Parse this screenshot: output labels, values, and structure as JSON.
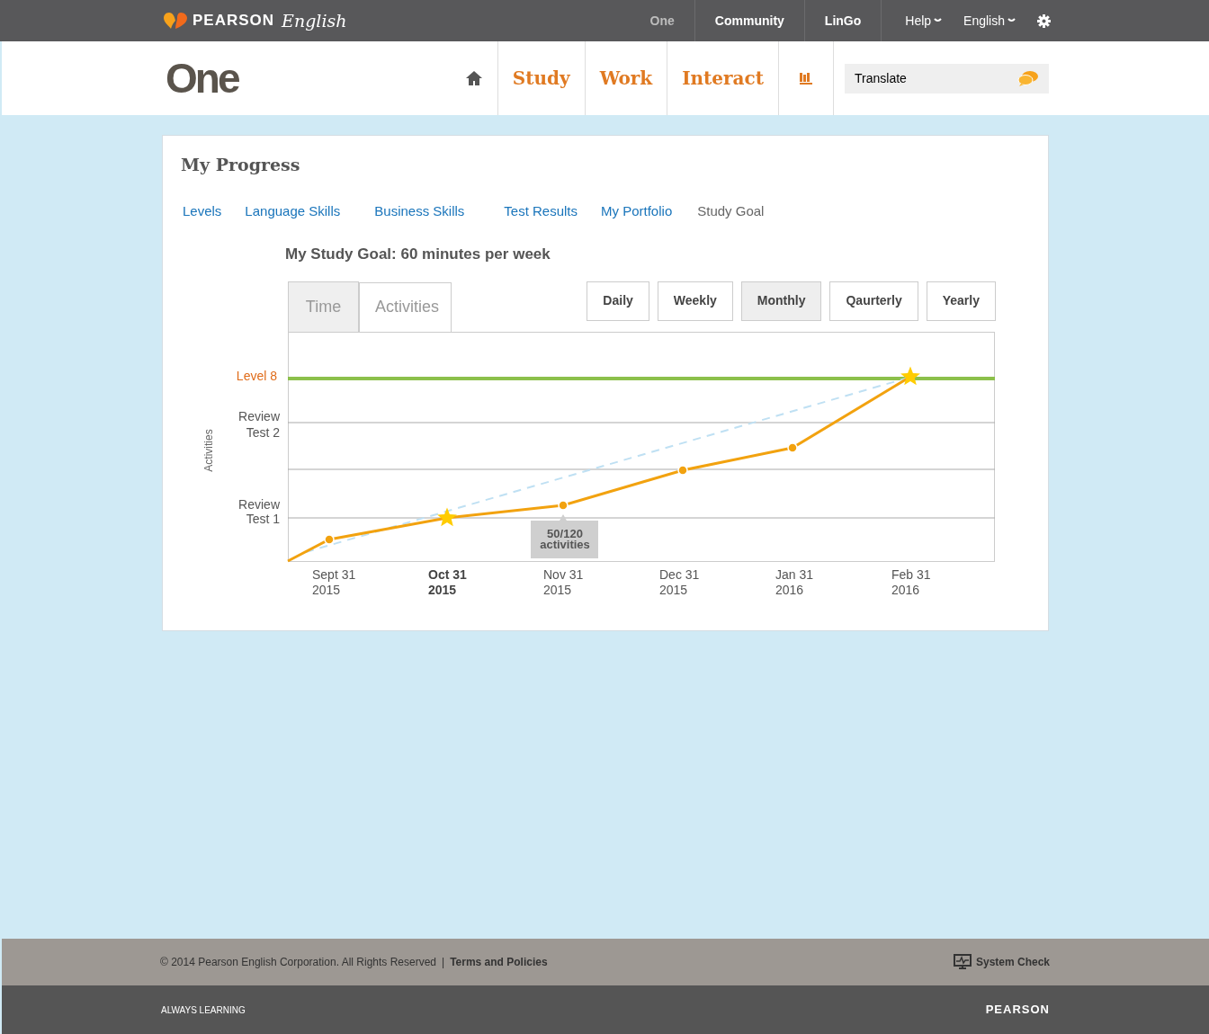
{
  "top_bar": {
    "brand": "PEARSON",
    "brand_script": "English",
    "links": [
      {
        "label": "One",
        "selected": true
      },
      {
        "label": "Community",
        "selected": false
      },
      {
        "label": "LinGo",
        "selected": false
      }
    ],
    "menus": [
      "Help",
      "English"
    ]
  },
  "header": {
    "logo": "One",
    "nav": [
      "Study",
      "Work",
      "Interact"
    ],
    "translate": {
      "label": "Translate"
    }
  },
  "card": {
    "title": "My Progress",
    "tabs": [
      {
        "label": "Levels",
        "selected": false
      },
      {
        "label": "Language Skills",
        "selected": false
      },
      {
        "label": "Business Skills",
        "selected": false
      },
      {
        "label": "Test Results",
        "selected": false
      },
      {
        "label": "My Portfolio",
        "selected": false
      },
      {
        "label": "Study Goal",
        "selected": true
      }
    ],
    "goal": "My Study Goal: 60 minutes per week",
    "view_tabs": [
      {
        "label": "Time",
        "selected": false
      },
      {
        "label": "Activities",
        "selected": true
      }
    ],
    "periods": [
      {
        "label": "Daily",
        "selected": false
      },
      {
        "label": "Weekly",
        "selected": false
      },
      {
        "label": "Monthly",
        "selected": true
      },
      {
        "label": "Qaurterly",
        "selected": false
      },
      {
        "label": "Yearly",
        "selected": false
      }
    ],
    "chart": {
      "y_title": "Activities",
      "goal_label": "Level 8",
      "y_labels": [
        [
          "Review",
          "Test 2"
        ],
        [
          "Review",
          "Test 1"
        ]
      ],
      "x_labels": [
        {
          "month": "Sept 31",
          "year": "2015",
          "selected": false
        },
        {
          "month": "Oct 31",
          "year": "2015",
          "selected": true
        },
        {
          "month": "Nov 31",
          "year": "2015",
          "selected": false
        },
        {
          "month": "Dec 31",
          "year": "2015",
          "selected": false
        },
        {
          "month": "Jan 31",
          "year": "2016",
          "selected": false
        },
        {
          "month": "Feb 31",
          "year": "2016",
          "selected": false
        }
      ],
      "tooltip": [
        "50/120",
        "activities"
      ]
    }
  },
  "footer": {
    "copyright": "© 2014 Pearson English Corporation. All Rights Reserved",
    "separator": "|",
    "terms": "Terms and Policies",
    "system_check": "System Check",
    "tagline": "ALWAYS LEARNING",
    "brand": "PEARSON"
  }
}
